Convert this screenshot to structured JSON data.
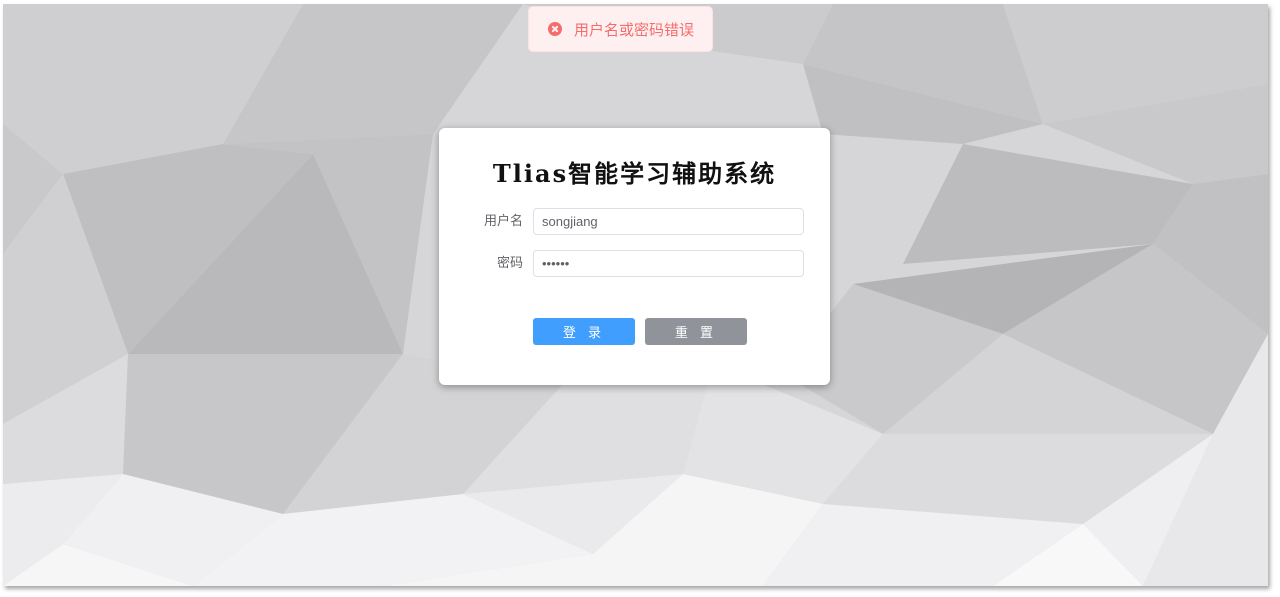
{
  "toast": {
    "type": "error",
    "icon": "circle-close-icon",
    "message": "用户名或密码错误",
    "color": "#f56c6c"
  },
  "login": {
    "title": "Tlias智能学习辅助系统",
    "username": {
      "label": "用户名",
      "value": "songjiang"
    },
    "password": {
      "label": "密码",
      "value": "••••••"
    },
    "buttons": {
      "login": "登 录",
      "reset": "重 置"
    }
  },
  "colors": {
    "primary": "#409eff",
    "info": "#909399",
    "danger": "#f56c6c"
  }
}
